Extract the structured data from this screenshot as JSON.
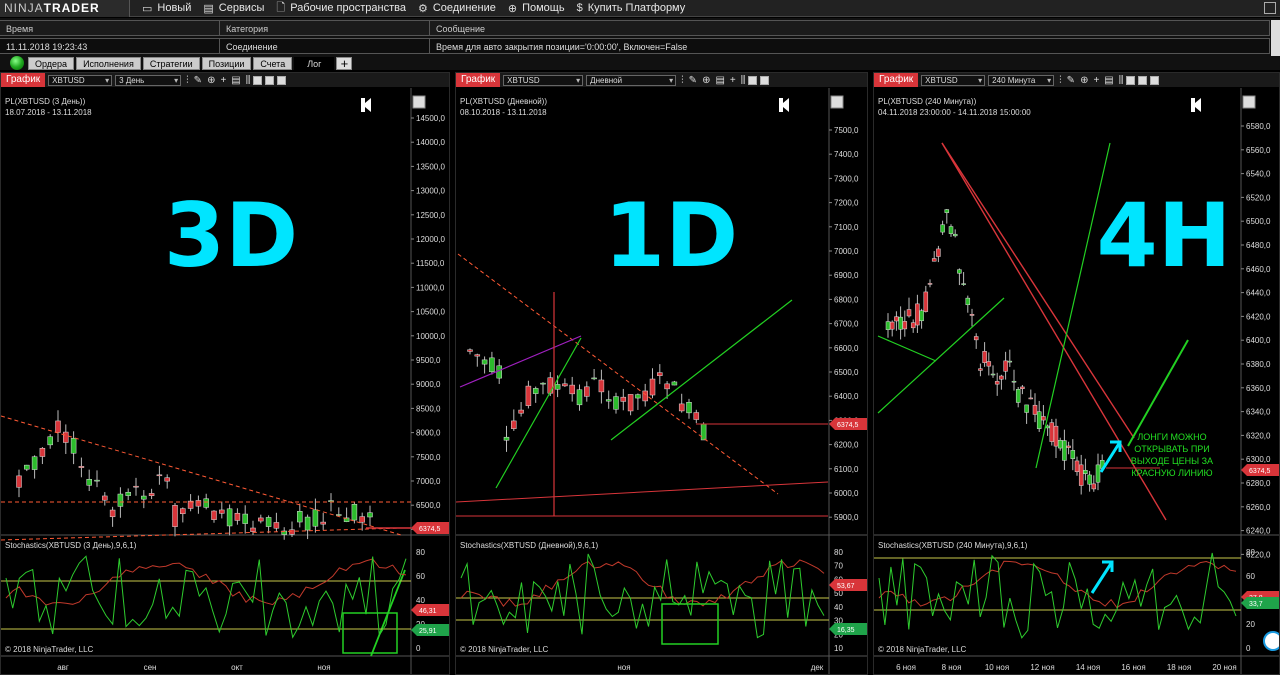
{
  "app": {
    "logo_ninja": "NINJA",
    "logo_trader": "TRADER",
    "menu": [
      {
        "icon": "new-icon",
        "label": "Новый"
      },
      {
        "icon": "services-icon",
        "label": "Сервисы"
      },
      {
        "icon": "workspaces-icon",
        "label": "Рабочие пространства"
      },
      {
        "icon": "connection-icon",
        "label": "Соединение"
      },
      {
        "icon": "help-icon",
        "label": "Помощь"
      },
      {
        "icon": "dollar-icon",
        "label": "Купить Платформу"
      }
    ]
  },
  "log": {
    "columns": [
      "Время",
      "Категория",
      "Сообщение"
    ],
    "row": [
      "11.11.2018 19:23:43",
      "Соединение",
      "Время для авто закрытия позиции='0:00:00', Включен=False"
    ]
  },
  "tabs": [
    "Ордера",
    "Исполнения",
    "Стратегии",
    "Позиции",
    "Счета",
    "Лог"
  ],
  "active_tab": "Лог",
  "charts": [
    {
      "tab_label": "График",
      "instrument": "XBTUSD",
      "period": "3 День",
      "title": "PL(XBTUSD (3 День))",
      "range": "18.07.2018 - 13.11.2018",
      "big_label": "3D",
      "indicator": "Stochastics(XBTUSD (3 День),9,6,1)",
      "copyright": "© 2018 NinjaTrader, LLC",
      "price_ticks": [
        "14500,0",
        "14000,0",
        "13500,0",
        "13000,0",
        "12500,0",
        "12000,0",
        "11500,0",
        "11000,0",
        "10500,0",
        "10000,0",
        "9500,0",
        "9000,0",
        "8500,0",
        "8000,0",
        "7500,0",
        "7000,0",
        "6500,0",
        "6000,0"
      ],
      "price_marker": "6374,5",
      "stoch_ticks": [
        "80",
        "60",
        "40",
        "20",
        "0"
      ],
      "stoch_markers": [
        "46,31",
        "25,91"
      ],
      "x_ticks": [
        "авг",
        "сен",
        "окт",
        "ноя"
      ]
    },
    {
      "tab_label": "График",
      "instrument": "XBTUSD",
      "period": "Дневной",
      "title": "PL(XBTUSD (Дневной))",
      "range": "08.10.2018 - 13.11.2018",
      "big_label": "1D",
      "indicator": "Stochastics(XBTUSD (Дневной),9,6,1)",
      "copyright": "© 2018 NinjaTrader, LLC",
      "price_ticks": [
        "7500,0",
        "7400,0",
        "7300,0",
        "7200,0",
        "7100,0",
        "7000,0",
        "6900,0",
        "6800,0",
        "6700,0",
        "6600,0",
        "6500,0",
        "6400,0",
        "6300,0",
        "6200,0",
        "6100,0",
        "6000,0",
        "5900,0"
      ],
      "price_marker": "6374,5",
      "stoch_ticks": [
        "80",
        "70",
        "60",
        "50",
        "40",
        "30",
        "20",
        "10"
      ],
      "stoch_markers": [
        "53,67",
        "16,35"
      ],
      "x_ticks": [
        "ноя",
        "дек"
      ]
    },
    {
      "tab_label": "График",
      "instrument": "XBTUSD",
      "period": "240 Минута",
      "title": "PL(XBTUSD (240 Минута))",
      "range": "04.11.2018 23:00:00 - 14.11.2018 15:00:00",
      "big_label": "4H",
      "indicator": "Stochastics(XBTUSD (240 Минута),9,6,1)",
      "copyright": "© 2018 NinjaTrader, LLC",
      "annotation": [
        "ЛОНГИ МОЖНО",
        "ОТКРЫВАТЬ ПРИ",
        "ВЫХОДЕ ЦЕНЫ ЗА",
        "КРАСНУЮ ЛИНИЮ"
      ],
      "price_ticks": [
        "6580,0",
        "6560,0",
        "6540,0",
        "6520,0",
        "6500,0",
        "6480,0",
        "6460,0",
        "6440,0",
        "6420,0",
        "6400,0",
        "6380,0",
        "6360,0",
        "6340,0",
        "6320,0",
        "6300,0",
        "6280,0",
        "6260,0",
        "6240,0",
        "6220,0"
      ],
      "price_marker": "6374,5",
      "stoch_ticks": [
        "80",
        "60",
        "40",
        "20",
        "0"
      ],
      "stoch_markers": [
        "37,8",
        "33,7"
      ],
      "x_ticks": [
        "6 ноя",
        "8 ноя",
        "10 ноя",
        "12 ноя",
        "14 ноя",
        "16 ноя",
        "18 ноя",
        "20 ноя"
      ]
    }
  ],
  "colors": {
    "accent": "#d8353a",
    "cyan": "#00e5ff",
    "bull": "#2cbc2c",
    "bear": "#d8353a",
    "stoch_k": "#2ecc2e",
    "stoch_d": "#c0392b",
    "level": "#c8c84a"
  }
}
